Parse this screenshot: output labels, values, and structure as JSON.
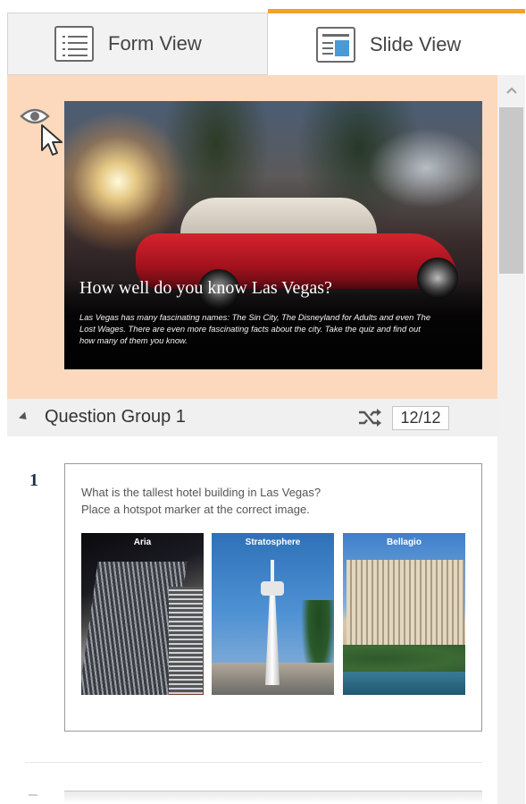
{
  "tabs": {
    "form_view": "Form View",
    "slide_view": "Slide View",
    "active": "slide_view"
  },
  "colors": {
    "active_tab_accent": "#f2a12a",
    "intro_highlight": "#fcd9bd",
    "slide_icon_accent": "#4a9ad6"
  },
  "icons": {
    "form_view": "list-icon",
    "slide_view": "slide-icon",
    "preview": "eye-icon",
    "shuffle": "shuffle-icon",
    "collapse": "triangle-down-icon",
    "scroll_up": "chevron-up-icon"
  },
  "intro_slide": {
    "title": "How well do you know Las Vegas?",
    "description": "Las Vegas has many fascinating names: The Sin City, The Disneyland for Adults and even The Lost Wages. There are even more fascinating facts about the city. Take the quiz and find out how many of them you know."
  },
  "question_group": {
    "label": "Question Group 1",
    "count": "12/12"
  },
  "questions": [
    {
      "number": "1",
      "line1": "What is the tallest hotel building in Las Vegas?",
      "line2": "Place a hotspot marker at the correct image.",
      "images": [
        {
          "label": "Aria"
        },
        {
          "label": "Stratosphere"
        },
        {
          "label": "Bellagio"
        }
      ]
    }
  ]
}
